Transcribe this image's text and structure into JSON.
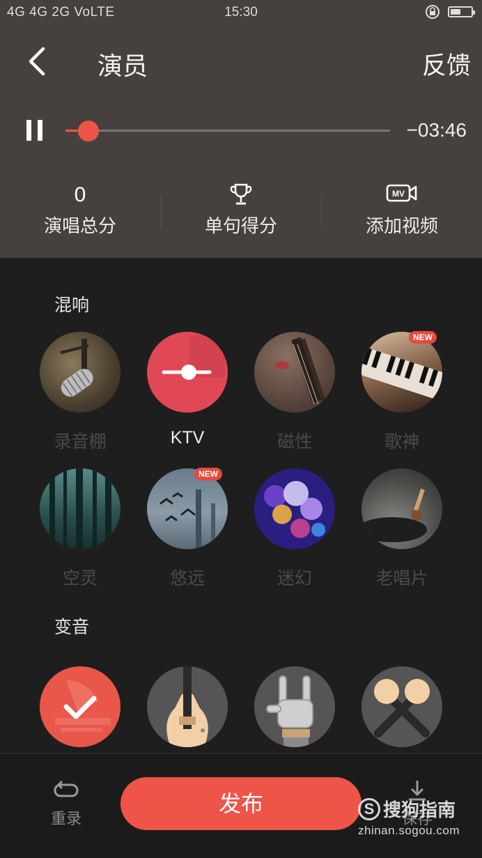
{
  "status_bar": {
    "network": "4G 4G 2G VoLTE",
    "time": "15:30"
  },
  "header": {
    "title": "演员",
    "feedback_label": "反馈"
  },
  "player": {
    "remaining": "−03:46",
    "progress": 0.07
  },
  "stats": [
    {
      "value": "0",
      "label": "演唱总分",
      "icon": ""
    },
    {
      "value": "",
      "label": "单句得分",
      "icon": "trophy-icon"
    },
    {
      "value": "",
      "label": "添加视频",
      "icon": "mv-camera-icon"
    }
  ],
  "reverb": {
    "title": "混响",
    "items": [
      {
        "label": "录音棚",
        "icon": "studio-microphone-icon",
        "active": false,
        "is_new": false
      },
      {
        "label": "KTV",
        "icon": "ktv-slider-icon",
        "active": true,
        "is_new": false
      },
      {
        "label": "磁性",
        "icon": "guitar-icon",
        "active": false,
        "is_new": false
      },
      {
        "label": "歌神",
        "icon": "piano-icon",
        "active": false,
        "is_new": true
      },
      {
        "label": "空灵",
        "icon": "forest-icon",
        "active": false,
        "is_new": false
      },
      {
        "label": "悠远",
        "icon": "birds-bridge-icon",
        "active": false,
        "is_new": true
      },
      {
        "label": "迷幻",
        "icon": "bokeh-lights-icon",
        "active": false,
        "is_new": false
      },
      {
        "label": "老唱片",
        "icon": "record-player-icon",
        "active": false,
        "is_new": false
      }
    ]
  },
  "voice_change": {
    "title": "变音",
    "items": [
      {
        "icon": "gramophone-check-icon",
        "active": true
      },
      {
        "icon": "electric-guitar-icon",
        "active": false
      },
      {
        "icon": "rock-hand-icon",
        "active": false
      },
      {
        "icon": "crossed-microphones-icon",
        "active": false
      }
    ]
  },
  "bottom_bar": {
    "redo_label": "重录",
    "publish_label": "发布",
    "save_label": "保存"
  },
  "watermark": {
    "brand": "搜狗指南",
    "url": "zhinan.sogou.com"
  },
  "colors": {
    "accent": "#ee5447",
    "header_bg": "#46413f",
    "body_bg": "#1e1e1e"
  }
}
